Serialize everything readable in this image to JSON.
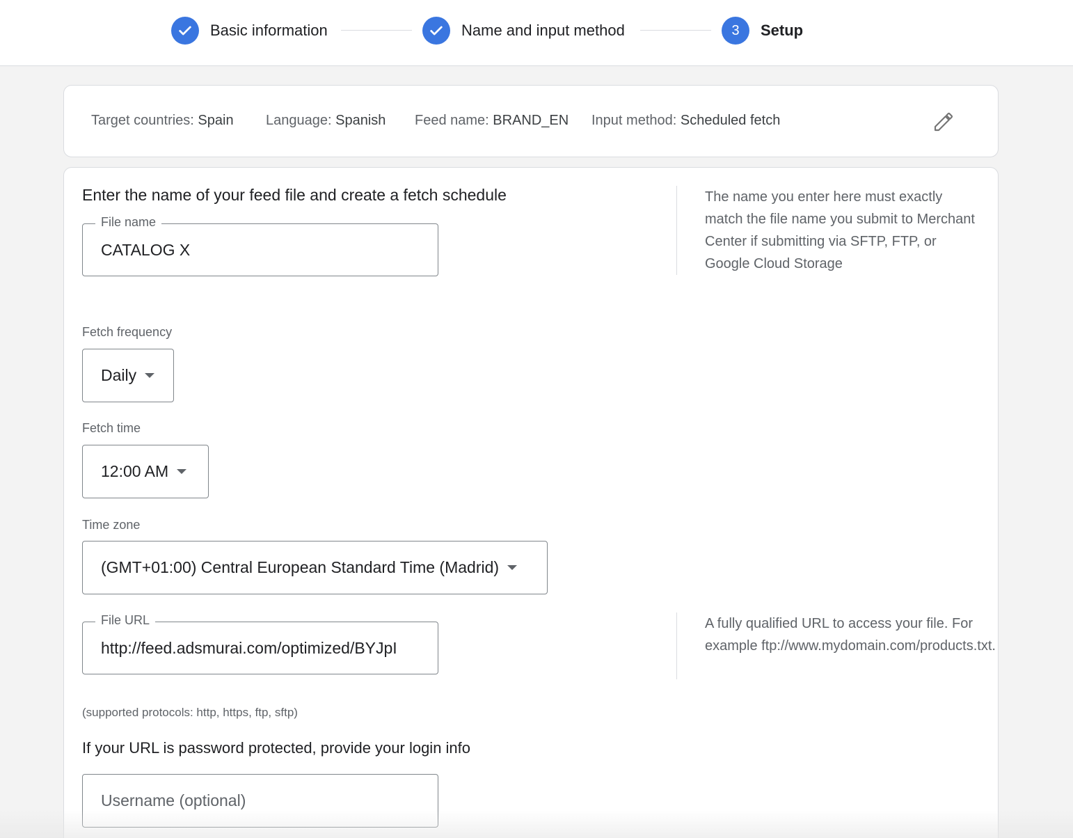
{
  "stepper": {
    "steps": [
      {
        "label": "Basic information",
        "state": "done"
      },
      {
        "label": "Name and input method",
        "state": "done"
      },
      {
        "number": "3",
        "label": "Setup",
        "state": "active"
      }
    ]
  },
  "summary": {
    "target_countries": {
      "label": "Target countries:",
      "value": "Spain"
    },
    "language": {
      "label": "Language:",
      "value": "Spanish"
    },
    "feed_name": {
      "label": "Feed name:",
      "value": "BRAND_EN"
    },
    "input_method": {
      "label": "Input method:",
      "value": "Scheduled fetch"
    },
    "edit_icon": "pencil-icon"
  },
  "form": {
    "heading": "Enter the name of your feed file and create a fetch schedule",
    "file_name": {
      "label": "File name",
      "value": "CATALOG X"
    },
    "file_name_help": "The name you enter here must exactly match the file name you submit to Merchant Center if submitting via SFTP, FTP, or Google Cloud Storage",
    "fetch_frequency": {
      "label": "Fetch frequency",
      "value": "Daily"
    },
    "fetch_time": {
      "label": "Fetch time",
      "value": "12:00 AM"
    },
    "time_zone": {
      "label": "Time zone",
      "value": "(GMT+01:00) Central European Standard Time (Madrid)"
    },
    "file_url": {
      "label": "File URL",
      "value": "http://feed.adsmurai.com/optimized/BYJpI"
    },
    "file_url_help": "A fully qualified URL to access your file. For example ftp://www.mydomain.com/products.txt.",
    "protocols_note": "(supported protocols: http, https, ftp, sftp)",
    "login_heading": "If your URL is password protected, provide your login info",
    "username": {
      "placeholder": "Username (optional)"
    }
  },
  "colors": {
    "accent": "#3a76e0",
    "background": "#f3f3f3"
  }
}
